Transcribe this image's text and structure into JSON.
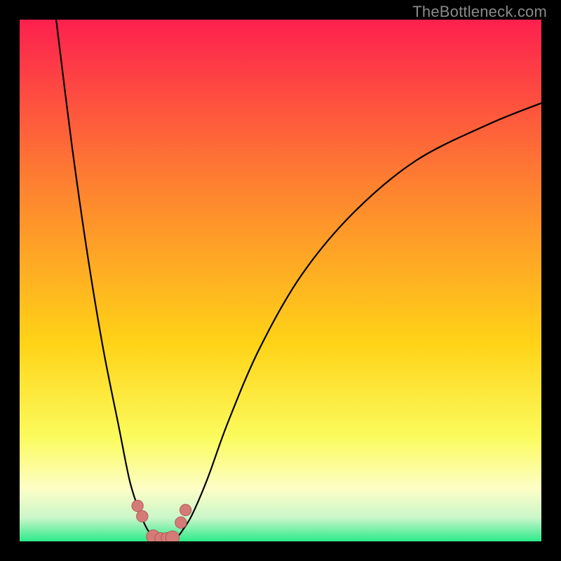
{
  "watermark": "TheBottleneck.com",
  "colors": {
    "bg_top": "#fd204e",
    "bg_mid1": "#fe8230",
    "bg_mid2": "#ffd317",
    "bg_mid3": "#fbfb5d",
    "bg_mid4": "#e4f9b2",
    "bg_bottom": "#2dea8a",
    "curve": "#000000",
    "dot_fill": "#d57b77",
    "dot_stroke": "#b15d5a"
  },
  "chart_data": {
    "type": "line",
    "title": "",
    "xlabel": "",
    "ylabel": "",
    "xlim": [
      0,
      100
    ],
    "ylim": [
      0,
      100
    ],
    "series": [
      {
        "name": "left-branch",
        "x": [
          7,
          10,
          13,
          16,
          19,
          21,
          22.5,
          24,
          25,
          26
        ],
        "y": [
          100,
          76,
          55,
          37,
          22,
          12,
          7,
          3.2,
          1.5,
          0.5
        ]
      },
      {
        "name": "right-branch",
        "x": [
          30,
          31,
          33,
          36,
          40,
          46,
          54,
          64,
          76,
          90,
          100
        ],
        "y": [
          0.5,
          1.8,
          5,
          12,
          23,
          37,
          51,
          63,
          73,
          80,
          84
        ]
      }
    ],
    "floor_segment": {
      "x": [
        26,
        30
      ],
      "y": [
        0.5,
        0.5
      ]
    },
    "markers": [
      {
        "x": 22.6,
        "y": 6.8,
        "r": 1.1
      },
      {
        "x": 23.5,
        "y": 4.8,
        "r": 1.1
      },
      {
        "x": 25.6,
        "y": 0.9,
        "r": 1.3
      },
      {
        "x": 27.0,
        "y": 0.6,
        "r": 1.1
      },
      {
        "x": 28.2,
        "y": 0.6,
        "r": 1.1
      },
      {
        "x": 29.3,
        "y": 0.7,
        "r": 1.3
      },
      {
        "x": 30.9,
        "y": 3.6,
        "r": 1.1
      },
      {
        "x": 31.8,
        "y": 6.0,
        "r": 1.1
      }
    ],
    "gradient_stops": [
      {
        "offset": 0,
        "color": "#fd204e"
      },
      {
        "offset": 0.32,
        "color": "#fe8230"
      },
      {
        "offset": 0.62,
        "color": "#ffd317"
      },
      {
        "offset": 0.8,
        "color": "#fbfb5d"
      },
      {
        "offset": 0.9,
        "color": "#fdfec7"
      },
      {
        "offset": 0.955,
        "color": "#c9f6c9"
      },
      {
        "offset": 1.0,
        "color": "#2dea8a"
      }
    ]
  }
}
